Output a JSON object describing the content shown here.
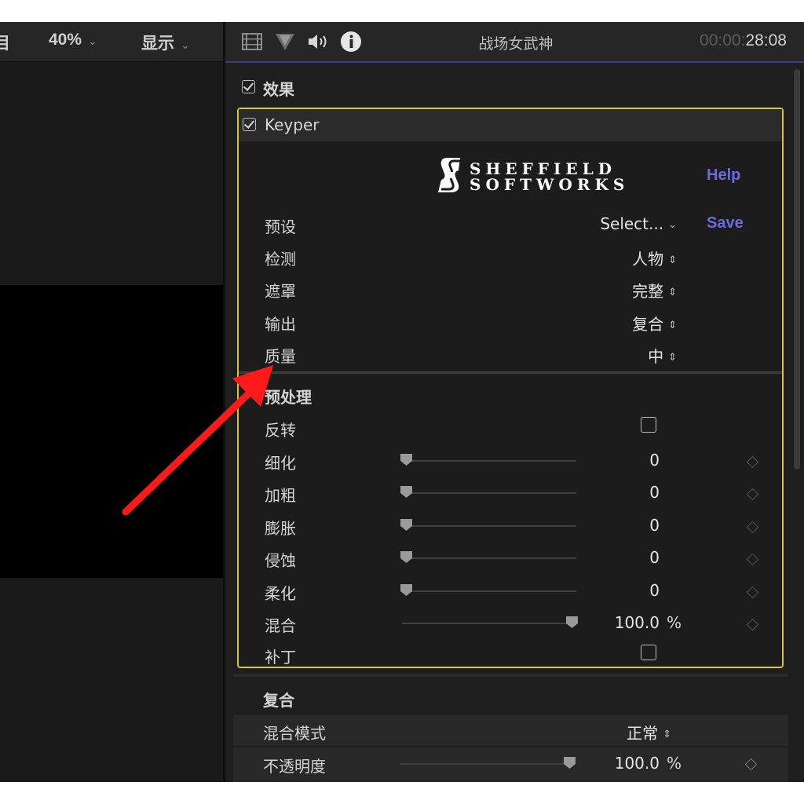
{
  "viewer": {
    "left_cut_label": "目",
    "zoom": "40%",
    "display": "显示"
  },
  "inspector": {
    "clip_title": "战场女武神",
    "timecode_dim": "00:00:",
    "timecode": "28:08"
  },
  "effects": {
    "section_label": "效果",
    "plugin_name": "Keyper",
    "logo_line1": "SHEFFIELD",
    "logo_line2": "SOFTWORKS",
    "help_label": "Help",
    "save_label": "Save",
    "params": [
      {
        "label": "预设",
        "value": "Select..."
      },
      {
        "label": "检测",
        "value": "人物"
      },
      {
        "label": "遮罩",
        "value": "完整"
      },
      {
        "label": "输出",
        "value": "复合"
      },
      {
        "label": "质量",
        "value": "中"
      }
    ],
    "preprocess": {
      "heading": "预处理",
      "invert_label": "反转",
      "sliders": [
        {
          "label": "细化",
          "value": "0",
          "level": 0
        },
        {
          "label": "加粗",
          "value": "0",
          "level": 0
        },
        {
          "label": "膨胀",
          "value": "0",
          "level": 0
        },
        {
          "label": "侵蚀",
          "value": "0",
          "level": 0
        },
        {
          "label": "柔化",
          "value": "0",
          "level": 0
        },
        {
          "label": "混合",
          "value": "100.0",
          "unit": "%",
          "level": 1
        }
      ],
      "patch_label": "补丁"
    }
  },
  "composite": {
    "heading": "复合",
    "blend_mode_label": "混合模式",
    "blend_mode_value": "正常",
    "opacity_label": "不透明度",
    "opacity_value": "100.0",
    "opacity_unit": "%",
    "opacity_level": 1
  },
  "colors": {
    "accent_link": "#6b6be0",
    "selection_border": "#d9c530",
    "annotation_arrow": "#ff1a1a"
  }
}
